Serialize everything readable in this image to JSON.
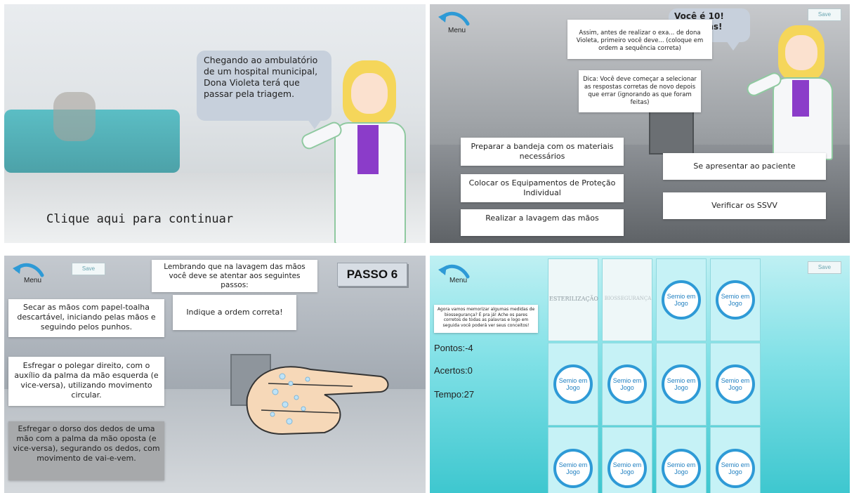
{
  "panel1": {
    "bubble_text": "Chegando ao ambulatório de um hospital municipal, Dona Violeta terá que passar pela triagem.",
    "continue_text": "Clique aqui para continuar"
  },
  "panel2": {
    "menu_label": "Menu",
    "save_label": "Save",
    "bubble_text": "Você é 10! Parabéns!",
    "instruction": "Assim, antes de realizar o exa... de dona Violeta, primeiro você deve... (coloque em ordem a sequência correta)",
    "hint": "Dica: Você deve começar a selecionar as respostas corretas de novo depois que errar (ignorando as que foram feitas)",
    "options": [
      "Preparar a bandeja com os materiais necessários",
      "Colocar os Equipamentos de Proteção Individual",
      "Realizar a lavagem das mãos",
      "Se apresentar ao paciente",
      "Verificar os SSVV"
    ]
  },
  "panel3": {
    "menu_label": "Menu",
    "save_label": "Save",
    "header": "Lembrando que na lavagem das mãos você deve se atentar aos seguintes passos:",
    "step_title": "PASSO 6",
    "prompt": "Indique a ordem correta!",
    "steps": [
      "Secar as mãos com papel-toalha descartável, iniciando pelas mãos e seguindo pelos punhos.",
      "Esfregar o polegar direito, com o auxílio da palma da mão esquerda (e vice-versa), utilizando movimento circular.",
      "Esfregar o dorso dos dedos de uma mão com a palma da mão oposta (e vice-versa), segurando os dedos, com movimento de vai-e-vem."
    ]
  },
  "panel4": {
    "menu_label": "Menu",
    "save_label": "Save",
    "instructions": "Agora vamos memorizar algumas medidas de biossegurança? É pra já! Ache os pares corretos de todas as palavras e logo em seguida você poderá ver seus conceitos!",
    "pontos": "Pontos:-4",
    "acertos": "Acertos:0",
    "tempo": "Tempo:27",
    "revealed_cards": [
      "ESTERILIZAÇÃO",
      "BIOSSEGURANÇA"
    ],
    "logo_text": "Semio em Jogo"
  },
  "colors": {
    "accent_blue": "#2e9ad6",
    "bubble": "#c7d0dc",
    "shirt": "#8b3cc9",
    "hair": "#f5d65a"
  }
}
